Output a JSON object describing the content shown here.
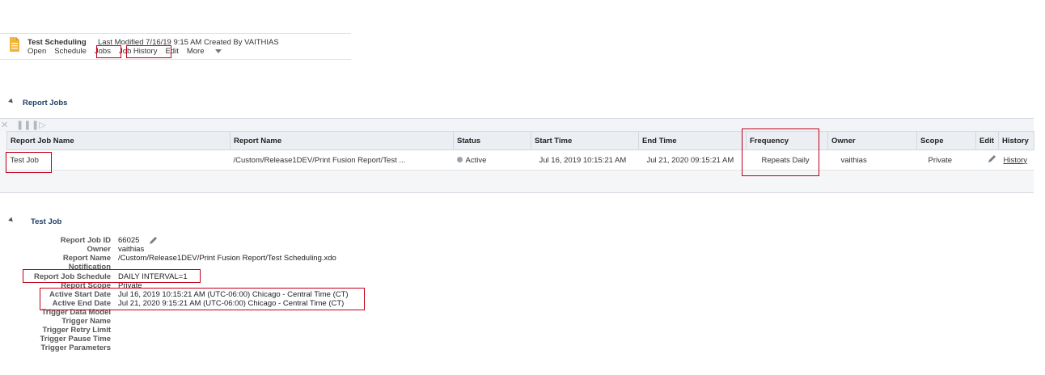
{
  "header": {
    "title": "Test Scheduling",
    "meta": "Last Modified 7/16/19 9:15 AM    Created By VAITHIAS",
    "links": [
      "Open",
      "Schedule",
      "Jobs",
      "Job History",
      "Edit",
      "More"
    ]
  },
  "report_jobs": {
    "section_title": "Report Jobs",
    "columns": [
      "Report Job Name",
      "Report Name",
      "Status",
      "Start Time",
      "End Time",
      "Frequency",
      "Owner",
      "Scope",
      "Edit",
      "History"
    ],
    "rows": [
      {
        "job_name": "Test Job",
        "report_name": "/Custom/Release1DEV/Print Fusion Report/Test ...",
        "status": "Active",
        "start_time": "Jul 16, 2019 10:15:21 AM",
        "end_time": "Jul 21, 2020 09:15:21 AM",
        "frequency": "Repeats Daily",
        "owner": "vaithias",
        "scope": "Private",
        "history": "History"
      }
    ]
  },
  "test_job": {
    "section_title": "Test Job",
    "fields": [
      {
        "label": "Report Job ID",
        "value": "66025"
      },
      {
        "label": "Owner",
        "value": "vaithias"
      },
      {
        "label": "Report Name",
        "value": "/Custom/Release1DEV/Print Fusion Report/Test Scheduling.xdo"
      },
      {
        "label": "Notification",
        "value": ""
      },
      {
        "label": "Report Job Schedule",
        "value": "DAILY INTERVAL=1"
      },
      {
        "label": "Report Scope",
        "value": "Private"
      },
      {
        "label": "Active Start Date",
        "value": "Jul 16, 2019 10:15:21 AM (UTC-06:00) Chicago - Central Time (CT)"
      },
      {
        "label": "Active End Date",
        "value": "Jul 21, 2020 9:15:21 AM (UTC-06:00) Chicago - Central Time (CT)"
      },
      {
        "label": "Trigger Data Model",
        "value": ""
      },
      {
        "label": "Trigger Name",
        "value": ""
      },
      {
        "label": "Trigger Retry Limit",
        "value": ""
      },
      {
        "label": "Trigger Pause Time",
        "value": ""
      },
      {
        "label": "Trigger Parameters",
        "value": ""
      }
    ]
  },
  "colors": {
    "accent": "#1a5d96",
    "highlight_box": "#c0001a",
    "header_bg": "#ebeef2"
  }
}
